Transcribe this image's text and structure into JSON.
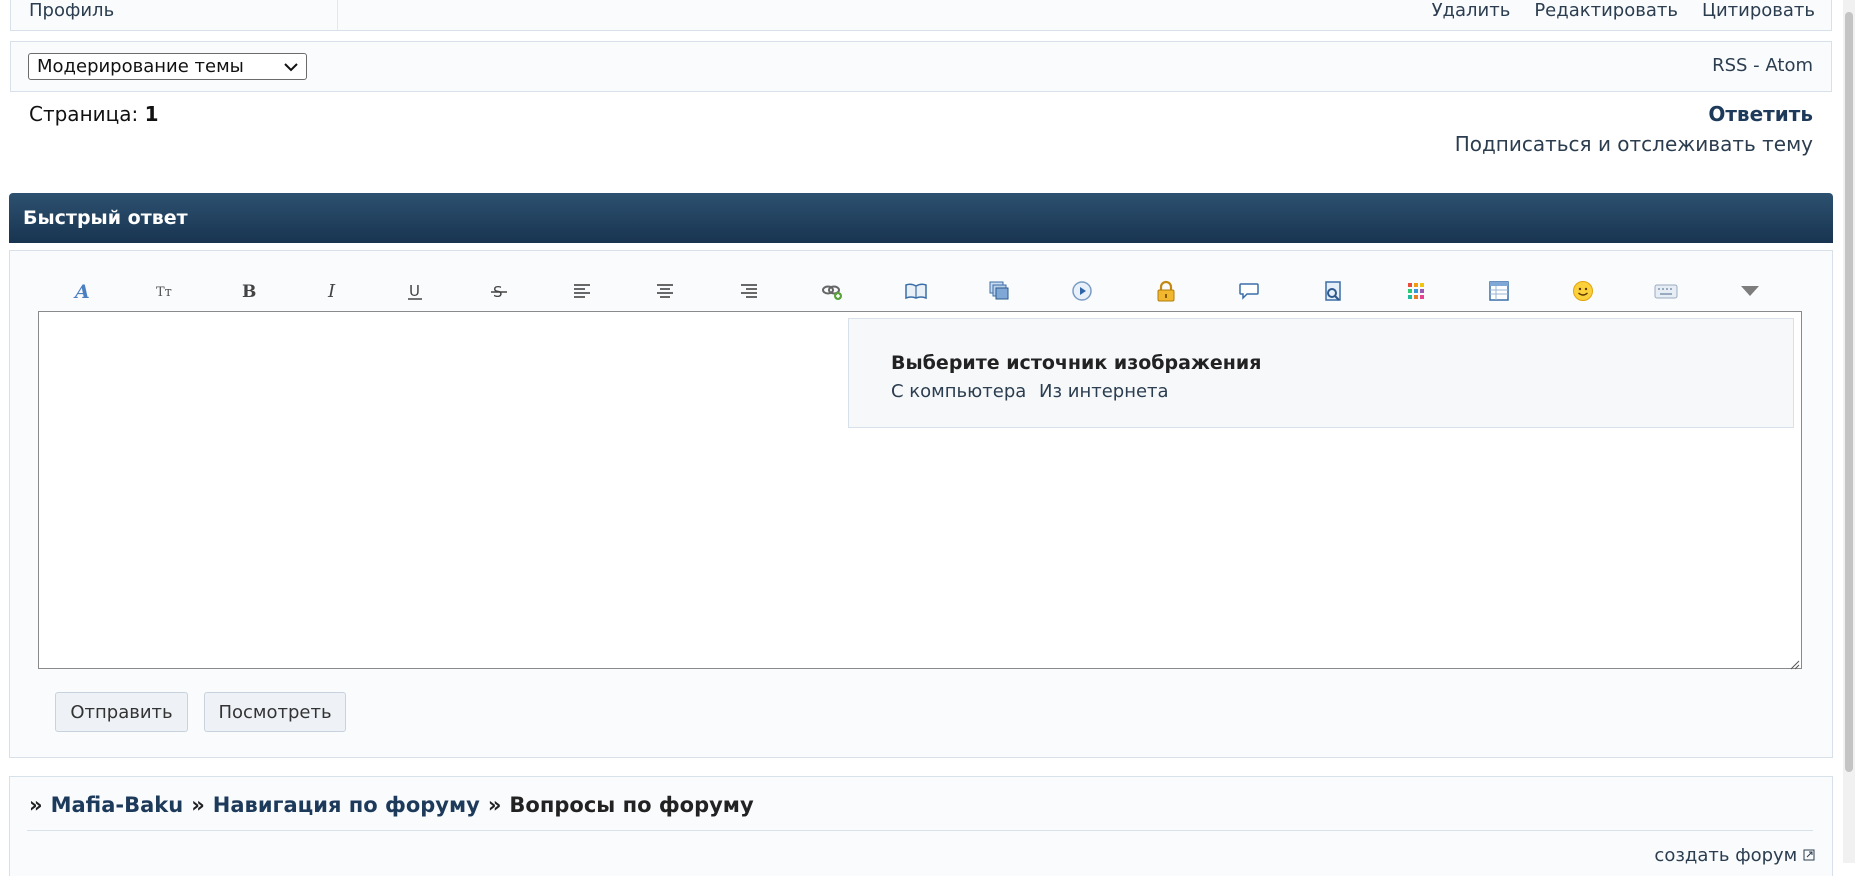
{
  "post_footer": {
    "profile": "Профиль",
    "actions": [
      "Удалить",
      "Редактировать",
      "Цитировать"
    ]
  },
  "moderation": {
    "select_value": "Модерирование темы",
    "rss": "RSS - Atom"
  },
  "pagination": {
    "label": "Страница:",
    "current": "1"
  },
  "reply": {
    "reply_link": "Ответить",
    "subscribe_link": "Подписаться и отслеживать тему"
  },
  "quick_reply": {
    "title": "Быстрый ответ",
    "toolbar": [
      "font-color-icon",
      "font-size-icon",
      "bold-icon",
      "italic-icon",
      "underline-icon",
      "strikethrough-icon",
      "align-left-icon",
      "align-center-icon",
      "align-right-icon",
      "link-icon",
      "image-book-icon",
      "gallery-icon",
      "video-icon",
      "lock-icon",
      "quote-icon",
      "spoiler-icon",
      "color-palette-icon",
      "table-icon",
      "smiley-icon",
      "keyboard-icon",
      "more-icon"
    ],
    "image_popup": {
      "title": "Выберите источник изображения",
      "from_computer": "С компьютера",
      "from_internet": "Из интернета"
    },
    "send_button": "Отправить",
    "preview_button": "Посмотреть"
  },
  "breadcrumb": {
    "sep": "»",
    "items": [
      "Mafia-Baku",
      "Навигация по форуму",
      "Вопросы по форуму"
    ]
  },
  "footer": {
    "create_forum": "создать форум"
  },
  "colors": {
    "header_top": "#2d5170",
    "header_bottom": "#183450",
    "link": "#1d3a5a",
    "border": "#d8e1ea"
  }
}
